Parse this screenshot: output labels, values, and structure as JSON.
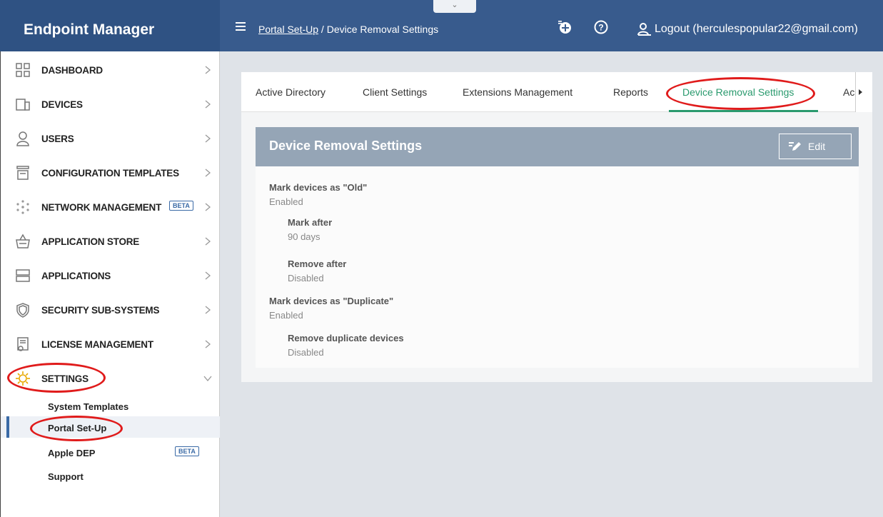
{
  "app": {
    "brand": "Endpoint Manager"
  },
  "header": {
    "breadcrumb_link": "Portal Set-Up",
    "breadcrumb_sep": " / ",
    "breadcrumb_current": "Device Removal Settings",
    "collapse_glyph": "⌄",
    "logout_label": "Logout (herculespopular22@gmail.com)",
    "icons": [
      "menu-icon",
      "add-icon",
      "help-icon",
      "user-icon"
    ]
  },
  "sidebar": {
    "items": [
      {
        "label": "DASHBOARD",
        "icon": "dashboard-icon"
      },
      {
        "label": "DEVICES",
        "icon": "devices-icon"
      },
      {
        "label": "USERS",
        "icon": "users-icon"
      },
      {
        "label": "CONFIGURATION TEMPLATES",
        "icon": "configuration-icon"
      },
      {
        "label": "NETWORK MANAGEMENT",
        "icon": "network-icon",
        "badge": "BETA"
      },
      {
        "label": "APPLICATION STORE",
        "icon": "store-icon"
      },
      {
        "label": "APPLICATIONS",
        "icon": "applications-icon"
      },
      {
        "label": "SECURITY SUB-SYSTEMS",
        "icon": "shield-icon"
      },
      {
        "label": "LICENSE MANAGEMENT",
        "icon": "license-icon"
      },
      {
        "label": "SETTINGS",
        "icon": "gear-icon"
      }
    ],
    "settings_sub": [
      {
        "label": "System Templates"
      },
      {
        "label": "Portal Set-Up"
      },
      {
        "label": "Apple DEP",
        "badge": "BETA"
      },
      {
        "label": "Support"
      }
    ]
  },
  "tabs": [
    {
      "label": "Active Directory"
    },
    {
      "label": "Client Settings"
    },
    {
      "label": "Extensions Management"
    },
    {
      "label": "Reports"
    },
    {
      "label": "Device Removal Settings"
    },
    {
      "label": "Acco"
    }
  ],
  "panel": {
    "title": "Device Removal Settings",
    "edit_label": "Edit",
    "fields": [
      {
        "label": "Mark devices as \"Old\"",
        "value": "Enabled"
      },
      {
        "label": "Mark after",
        "value": "90 days"
      },
      {
        "label": "Remove after",
        "value": "Disabled"
      },
      {
        "label": "Mark devices as \"Duplicate\"",
        "value": "Enabled"
      },
      {
        "label": "Remove duplicate devices",
        "value": "Disabled"
      }
    ]
  },
  "colors": {
    "header": "#385b8d",
    "brand_bg": "#2f5283",
    "active_tab": "#2a9a6e",
    "panel_head": "#95a5b6",
    "annotation": "#e01b1b"
  }
}
